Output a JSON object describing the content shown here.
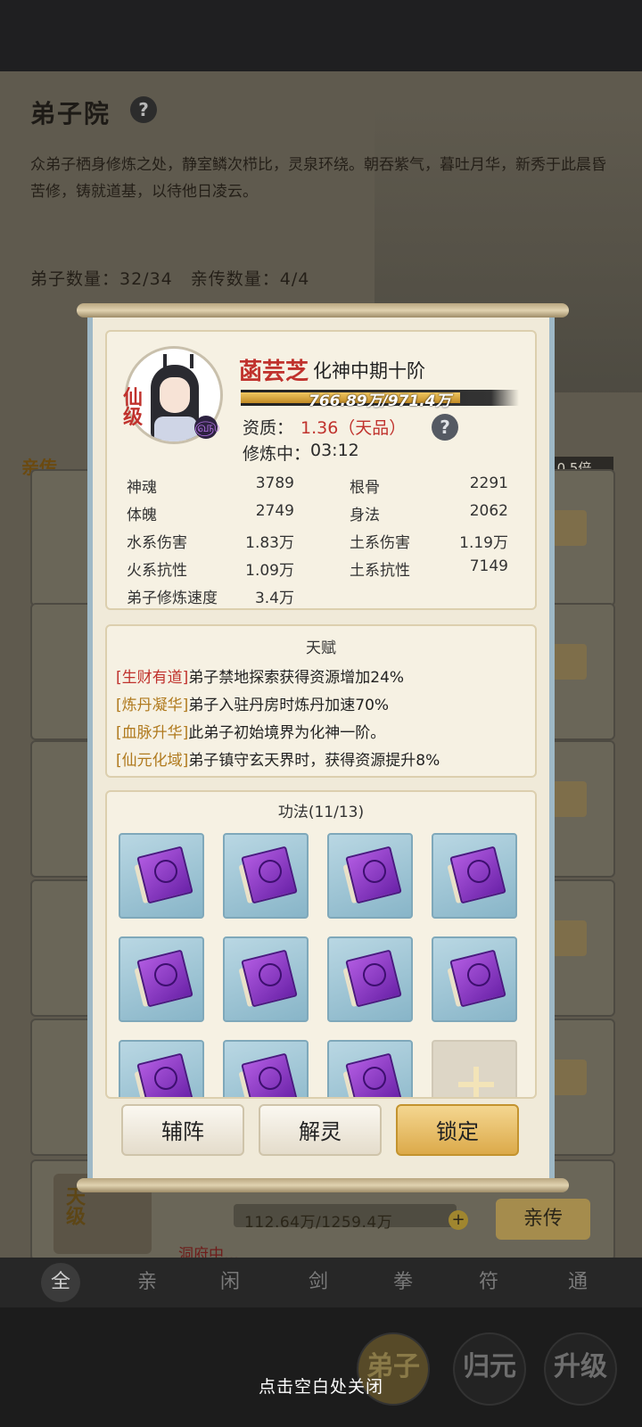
{
  "background": {
    "title": "弟子院",
    "help_icon": "?",
    "description": "众弟子栖身修炼之处，静室鳞次栉比，灵泉环绕。朝吞紫气，暮吐月华，新秀于此晨昏苦修，铸就道基，以待他日凌云。",
    "disciple_count": "弟子数量：32/34",
    "direct_count": "亲传数量：4/4",
    "direct_tag": "亲传",
    "rate_badge": "0.5倍",
    "bottom_card": {
      "grade_tag": "天级",
      "progress_text": "112.64万/1259.4万",
      "status": "洞府中…",
      "button": "亲传"
    },
    "filters": [
      "全",
      "亲",
      "闲",
      "剑",
      "拳",
      "符",
      "通"
    ],
    "nav": [
      "弟子",
      "归元",
      "升级"
    ],
    "close_hint": "点击空白处关闭"
  },
  "dialog": {
    "grade": "仙级",
    "name": "菡芸芝",
    "realm": "化神中期十阶",
    "xp_text": "766.89万/971.4万",
    "xp_progress": 0.79,
    "aptitude_label": "资质：",
    "aptitude_value": "1.36（天品）",
    "training_label": "修炼中：",
    "training_time": "03:12",
    "stats": [
      {
        "l1": "神魂",
        "v1": "3789",
        "l2": "根骨",
        "v2": "2291"
      },
      {
        "l1": "体魄",
        "v1": "2749",
        "l2": "身法",
        "v2": "2062"
      },
      {
        "l1": "水系伤害",
        "v1": "1.83万",
        "l2": "土系伤害",
        "v2": "1.19万"
      },
      {
        "l1": "火系抗性",
        "v1": "1.09万",
        "l2": "土系抗性",
        "v2": "7149"
      },
      {
        "l1": "弟子修炼速度",
        "v1": "3.4万",
        "l2": "",
        "v2": ""
      }
    ],
    "talent_title": "天赋",
    "talents": [
      {
        "tag": "[生财有道]",
        "text": "弟子禁地探索获得资源增加24%",
        "color": "#c0322d"
      },
      {
        "tag": "[炼丹凝华]",
        "text": "弟子入驻丹房时炼丹加速70%",
        "color": "#b07a1e"
      },
      {
        "tag": "[血脉升华]",
        "text": "此弟子初始境界为化神一阶。",
        "color": "#b07a1e"
      },
      {
        "tag": "[仙元化域]",
        "text": "弟子镇守玄天界时，获得资源提升8%",
        "color": "#b07a1e"
      }
    ],
    "skills_title": "功法(11/13)",
    "skill_icon": "purple-book-icon",
    "buttons": {
      "formation": "辅阵",
      "release": "解灵",
      "lock": "锁定"
    }
  }
}
